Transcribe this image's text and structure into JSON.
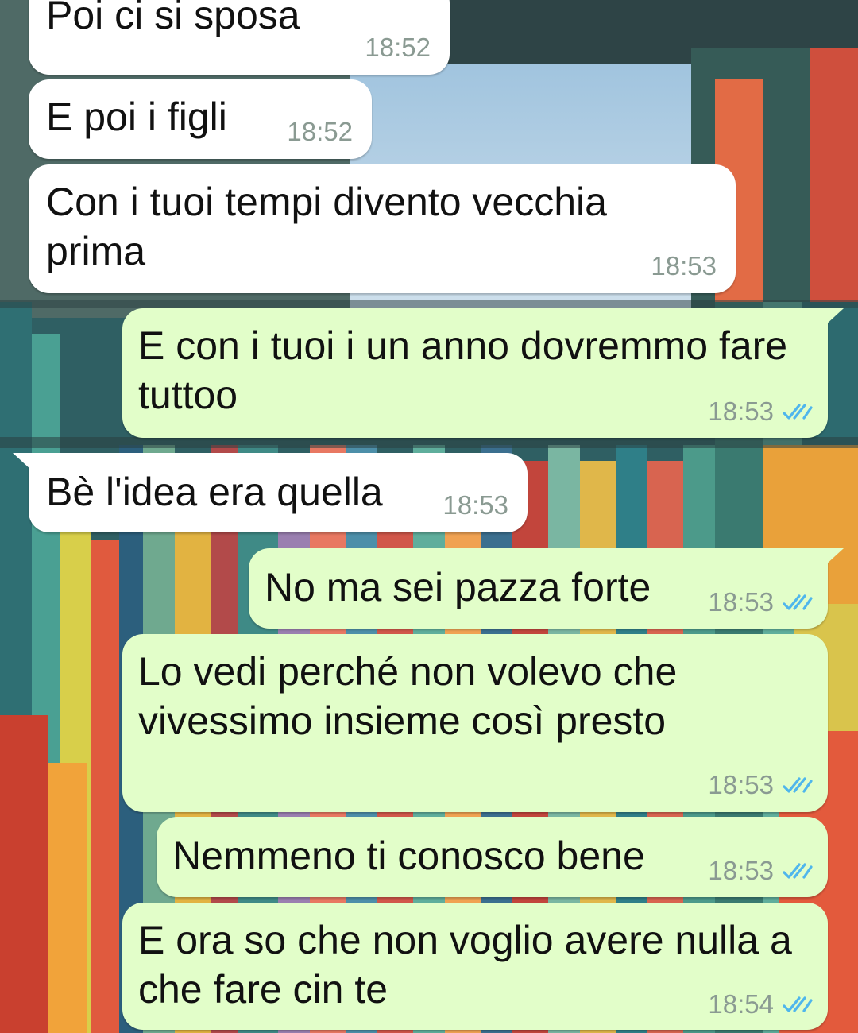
{
  "chat": {
    "messages": [
      {
        "text": "Poi ci si sposa",
        "time": "18:52",
        "direction": "incoming"
      },
      {
        "text": "E poi i figli",
        "time": "18:52",
        "direction": "incoming"
      },
      {
        "text": "Con i tuoi tempi divento vecchia\nprima",
        "time": "18:53",
        "direction": "incoming"
      },
      {
        "text": "E con i tuoi i un anno dovremmo fare\ntuttoo",
        "time": "18:53",
        "direction": "outgoing",
        "status": "read"
      },
      {
        "text": "Bè l'idea era quella",
        "time": "18:53",
        "direction": "incoming"
      },
      {
        "text": "No ma sei pazza forte",
        "time": "18:53",
        "direction": "outgoing",
        "status": "read"
      },
      {
        "text": "Lo vedi perché non volevo che\nvivessimo insieme così presto",
        "time": "18:53",
        "direction": "outgoing",
        "status": "read"
      },
      {
        "text": "Nemmeno ti conosco bene",
        "time": "18:53",
        "direction": "outgoing",
        "status": "read"
      },
      {
        "text": "E ora so che non voglio avere nulla a\nche fare cin te",
        "time": "18:54",
        "direction": "outgoing",
        "status": "read"
      }
    ]
  },
  "colors": {
    "incoming_bubble": "#ffffff",
    "outgoing_bubble": "#e2fec9",
    "timestamp": "#8a9a92",
    "read_ticks": "#4fb6ec"
  },
  "icons": {
    "read_receipt": "double-check-icon"
  }
}
